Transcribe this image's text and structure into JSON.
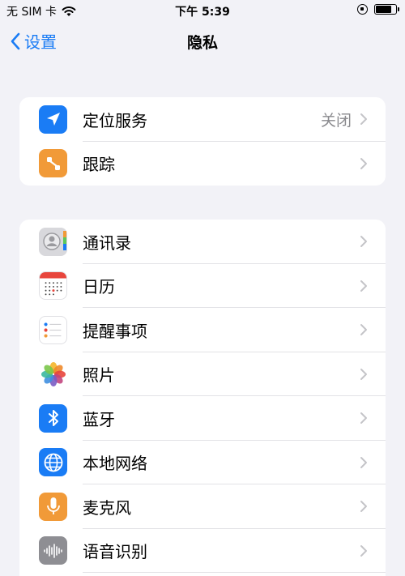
{
  "status_bar": {
    "carrier": "无 SIM 卡",
    "time": "下午 5:39",
    "battery_level": 0.8
  },
  "nav": {
    "back_label": "设置",
    "title": "隐私"
  },
  "groups": [
    {
      "items": [
        {
          "label": "定位服务",
          "value": "关闭",
          "icon": "location-arrow-icon",
          "color": "#1a7cf5"
        },
        {
          "label": "跟踪",
          "value": "",
          "icon": "tracking-icon",
          "color": "#f19a38"
        }
      ]
    },
    {
      "items": [
        {
          "label": "通讯录",
          "icon": "contacts-icon",
          "color": "#d8d8dc"
        },
        {
          "label": "日历",
          "icon": "calendar-icon",
          "color": "#ffffff"
        },
        {
          "label": "提醒事项",
          "icon": "reminders-icon",
          "color": "#ffffff"
        },
        {
          "label": "照片",
          "icon": "photos-icon",
          "color": "#ffffff"
        },
        {
          "label": "蓝牙",
          "icon": "bluetooth-icon",
          "color": "#1a7cf5"
        },
        {
          "label": "本地网络",
          "icon": "globe-icon",
          "color": "#1a7cf5"
        },
        {
          "label": "麦克风",
          "icon": "microphone-icon",
          "color": "#f19a38"
        },
        {
          "label": "语音识别",
          "icon": "waveform-icon",
          "color": "#8e8e93"
        }
      ]
    }
  ],
  "colors": {
    "accent": "#1a7cf5",
    "background": "#f2f2f7",
    "secondary_text": "#8a8a8e"
  }
}
